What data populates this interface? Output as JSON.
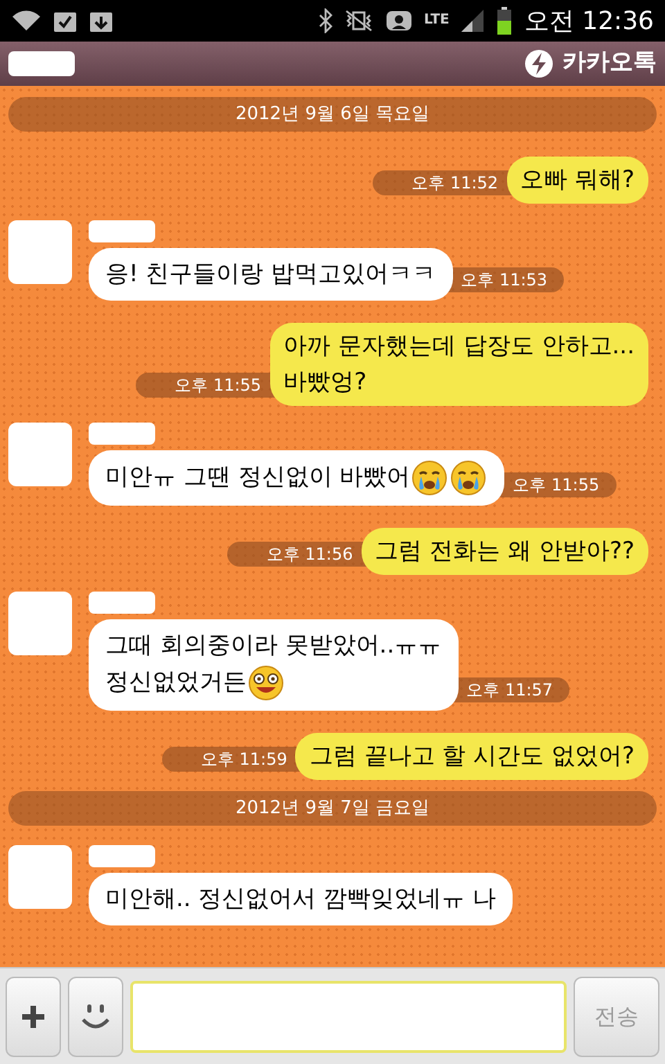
{
  "status_bar": {
    "network": "LTE",
    "time": "오전 12:36"
  },
  "header": {
    "app_name": "카카오톡"
  },
  "messages": [
    {
      "kind": "date",
      "text": "2012년 9월 6일 목요일"
    },
    {
      "kind": "sent",
      "lines": [
        "오빠 뭐해?"
      ],
      "time": "오후 11:52"
    },
    {
      "kind": "received",
      "lines": [
        "응! 친구들이랑 밥먹고있어ㅋㅋ"
      ],
      "time": "오후 11:53"
    },
    {
      "kind": "sent",
      "lines": [
        "아까 문자했는데 답장도 안하고...",
        "바빴엉?"
      ],
      "time": "오후 11:55"
    },
    {
      "kind": "received",
      "lines": [
        "미안ㅠ 그땐 정신없이 바빴어"
      ],
      "emojis": [
        {
          "kind": "crying"
        },
        {
          "kind": "crying"
        }
      ],
      "time": "오후 11:55"
    },
    {
      "kind": "sent",
      "lines": [
        "그럼 전화는 왜 안받아??"
      ],
      "time": "오후 11:56"
    },
    {
      "kind": "received",
      "lines": [
        "그때 회의중이라 못받았어..ㅠㅠ",
        "정신없었거든"
      ],
      "emojis": [
        {
          "kind": "dizzy"
        }
      ],
      "time": "오후 11:57"
    },
    {
      "kind": "sent",
      "lines": [
        "그럼 끝나고 할 시간도 없었어?"
      ],
      "time": "오후 11:59"
    },
    {
      "kind": "date",
      "text": "2012년 9월 7일 금요일"
    },
    {
      "kind": "received",
      "lines": [
        "미안해.. 정신없어서 깜빡잊었네ㅠ 나"
      ]
    }
  ],
  "send_button": {
    "label": "전송",
    "disabled": true
  }
}
